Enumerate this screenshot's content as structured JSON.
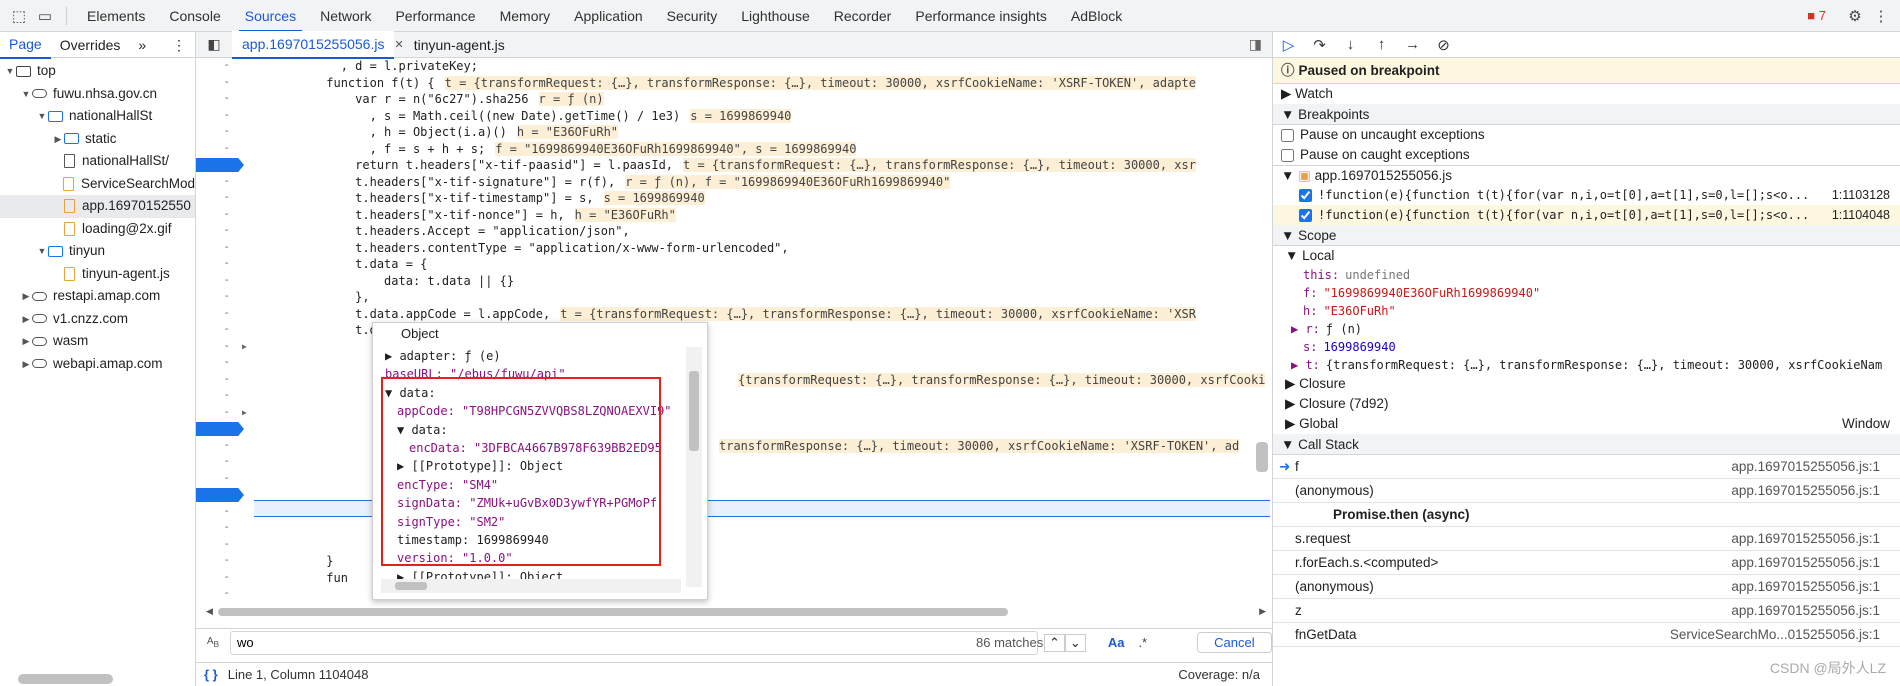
{
  "toolbar": {
    "tabs": [
      "Elements",
      "Console",
      "Sources",
      "Network",
      "Performance",
      "Memory",
      "Application",
      "Security",
      "Lighthouse",
      "Recorder",
      "Performance insights",
      "AdBlock"
    ],
    "issues_count": "7"
  },
  "sidebar": {
    "tabs": [
      "Page",
      "Overrides"
    ],
    "tree": [
      {
        "label": "top",
        "depth": 0,
        "kind": "frame",
        "arrow": "▼"
      },
      {
        "label": "fuwu.nhsa.gov.cn",
        "depth": 1,
        "kind": "cloud",
        "arrow": "▼"
      },
      {
        "label": "nationalHallSt",
        "depth": 2,
        "kind": "folder",
        "arrow": "▼"
      },
      {
        "label": "static",
        "depth": 3,
        "kind": "folder",
        "arrow": "▶"
      },
      {
        "label": "nationalHallSt/",
        "depth": 3,
        "kind": "file",
        "arrow": ""
      },
      {
        "label": "ServiceSearchMod",
        "depth": 3,
        "kind": "js",
        "arrow": ""
      },
      {
        "label": "app.16970152550",
        "depth": 3,
        "kind": "js",
        "arrow": "",
        "selected": true
      },
      {
        "label": "loading@2x.gif",
        "depth": 3,
        "kind": "js",
        "arrow": ""
      },
      {
        "label": "tinyun",
        "depth": 2,
        "kind": "folder",
        "arrow": "▼"
      },
      {
        "label": "tinyun-agent.js",
        "depth": 3,
        "kind": "js",
        "arrow": ""
      },
      {
        "label": "restapi.amap.com",
        "depth": 1,
        "kind": "cloud",
        "arrow": "▶"
      },
      {
        "label": "v1.cnzz.com",
        "depth": 1,
        "kind": "cloud",
        "arrow": "▶"
      },
      {
        "label": "wasm",
        "depth": 1,
        "kind": "cloud",
        "arrow": "▶"
      },
      {
        "label": "webapi.amap.com",
        "depth": 1,
        "kind": "cloud",
        "arrow": "▶"
      }
    ]
  },
  "editor": {
    "tabs": [
      "app.1697015255056.js",
      "tinyun-agent.js"
    ],
    "lines": [
      {
        "i": 0,
        "code": "            , d = l.privateKey;",
        "inline": ""
      },
      {
        "i": 1,
        "code": "          function f(t) {",
        "inline": "t = {transformRequest: {…}, transformResponse: {…}, timeout: 30000, xsrfCookieName: 'XSRF-TOKEN', adapte"
      },
      {
        "i": 2,
        "code": "              var r = n(\"6c27\").sha256",
        "inline": "r = ƒ (n)"
      },
      {
        "i": 3,
        "code": "                , s = Math.ceil((new Date).getTime() / 1e3)",
        "inline": "s = 1699869940"
      },
      {
        "i": 4,
        "code": "                , h = Object(i.a)()",
        "inline": "h = \"E36OFuRh\""
      },
      {
        "i": 5,
        "code": "                , f = s + h + s;",
        "inline": "f = \"1699869940E36OFuRh1699869940\", s = 1699869940"
      },
      {
        "i": 6,
        "code": "              return t.headers[\"x-tif-paasid\"] = l.paasId,",
        "inline": "t = {transformRequest: {…}, transformResponse: {…}, timeout: 30000, xsr"
      },
      {
        "i": 7,
        "code": "              t.headers[\"x-tif-signature\"] = r(f),",
        "inline": "r = ƒ (n), f = \"1699869940E36OFuRh1699869940\""
      },
      {
        "i": 8,
        "code": "              t.headers[\"x-tif-timestamp\"] = s,",
        "inline": "s = 1699869940"
      },
      {
        "i": 9,
        "code": "              t.headers[\"x-tif-nonce\"] = h,",
        "inline": "h = \"E36OFuRh\""
      },
      {
        "i": 10,
        "code": "              t.headers.Accept = \"application/json\",",
        "inline": ""
      },
      {
        "i": 11,
        "code": "              t.headers.contentType = \"application/x-www-form-urlencoded\",",
        "inline": ""
      },
      {
        "i": 12,
        "code": "              t.data = {",
        "inline": ""
      },
      {
        "i": 13,
        "code": "                  data: t.data || {}",
        "inline": ""
      },
      {
        "i": 14,
        "code": "              },",
        "inline": ""
      },
      {
        "i": 15,
        "code": "              t.data.appCode = l.appCode,",
        "inline": "t = {transformRequest: {…}, transformResponse: {…}, timeout: 30000, xsrfCookieName: 'XSR"
      },
      {
        "i": 16,
        "code": "              t.data.version = l.version,",
        "inline": ""
      },
      {
        "i": 19,
        "code": "",
        "inline": "{transformRequest: {…}, transformResponse: {…}, timeout: 30000, xsrfCooki"
      },
      {
        "i": 23,
        "code": "",
        "inline": "transformResponse: {…}, timeout: 30000, xsrfCookieName: 'XSRF-TOKEN', ad"
      },
      {
        "i": 30,
        "code": "          }",
        "inline": ""
      },
      {
        "i": 31,
        "code": "          fun",
        "inline": ""
      }
    ]
  },
  "popup": {
    "title": "Object",
    "lines": [
      {
        "t": "▶ adapter: ƒ (e)",
        "d": 0
      },
      {
        "t": "baseURL: \"/ebus/fuwu/api\"",
        "d": 0
      },
      {
        "t": "▼ data:",
        "d": 0
      },
      {
        "t": "appCode: \"T98HPCGN5ZVVQBS8LZQNOAEXVI9\"",
        "d": 1
      },
      {
        "t": "▼ data:",
        "d": 1
      },
      {
        "t": "encData: \"3DFBCA4667B978F639BB2ED95",
        "d": 2
      },
      {
        "t": "▶ [[Prototype]]: Object",
        "d": 1
      },
      {
        "t": "encType: \"SM4\"",
        "d": 1
      },
      {
        "t": "signData: \"ZMUk+uGvBx0D3ywfYR+PGMoPf",
        "d": 1
      },
      {
        "t": "signType: \"SM2\"",
        "d": 1
      },
      {
        "t": "timestamp: 1699869940",
        "d": 1
      },
      {
        "t": "version: \"1.0.0\"",
        "d": 1
      },
      {
        "t": "▶ [[Prototype]]: Object",
        "d": 1
      }
    ]
  },
  "search": {
    "query": "wo",
    "matches": "86 matches",
    "case_label": "Aa",
    "regex_label": ".*",
    "cancel": "Cancel"
  },
  "status": {
    "position": "Line 1, Column 1104048",
    "coverage": "Coverage: n/a"
  },
  "debugger": {
    "paused": "Paused on breakpoint",
    "watch": "Watch",
    "breakpoints": "Breakpoints",
    "uncaught": "Pause on uncaught exceptions",
    "caught": "Pause on caught exceptions",
    "bp_file": "app.1697015255056.js",
    "bps": [
      {
        "code": "!function(e){function t(t){for(var n,i,o=t[0],a=t[1],s=0,l=[];s<o...",
        "loc": "1:1103128"
      },
      {
        "code": "!function(e){function t(t){for(var n,i,o=t[0],a=t[1],s=0,l=[];s<o...",
        "loc": "1:1104048"
      }
    ],
    "scope": "Scope",
    "local": "Local",
    "vars": [
      {
        "k": "this:",
        "v": "undefined",
        "c": "#777"
      },
      {
        "k": "f:",
        "v": "\"1699869940E36OFuRh1699869940\"",
        "c": "#c41a16"
      },
      {
        "k": "h:",
        "v": "\"E36OFuRh\"",
        "c": "#c41a16"
      },
      {
        "k": "▶ r:",
        "v": "ƒ (n)",
        "c": "#1f1f1f"
      },
      {
        "k": "s:",
        "v": "1699869940",
        "c": "#1c00cf"
      },
      {
        "k": "▶ t:",
        "v": "{transformRequest: {…}, transformResponse: {…}, timeout: 30000, xsrfCookieNam",
        "c": "#1f1f1f"
      }
    ],
    "closure": "Closure",
    "closure2": "Closure (7d92)",
    "global": "Global",
    "global_val": "Window",
    "callstack": "Call Stack",
    "frames": [
      {
        "fn": "f",
        "loc": "app.1697015255056.js:1"
      },
      {
        "fn": "(anonymous)",
        "loc": "app.1697015255056.js:1"
      },
      {
        "fn": "Promise.then (async)",
        "loc": ""
      },
      {
        "fn": "s.request",
        "loc": "app.1697015255056.js:1"
      },
      {
        "fn": "r.forEach.s.<computed>",
        "loc": "app.1697015255056.js:1"
      },
      {
        "fn": "(anonymous)",
        "loc": "app.1697015255056.js:1"
      },
      {
        "fn": "z",
        "loc": "app.1697015255056.js:1"
      },
      {
        "fn": "fnGetData",
        "loc": "ServiceSearchMo...015255056.js:1"
      }
    ],
    "watermark": "CSDN @局外人LZ"
  }
}
